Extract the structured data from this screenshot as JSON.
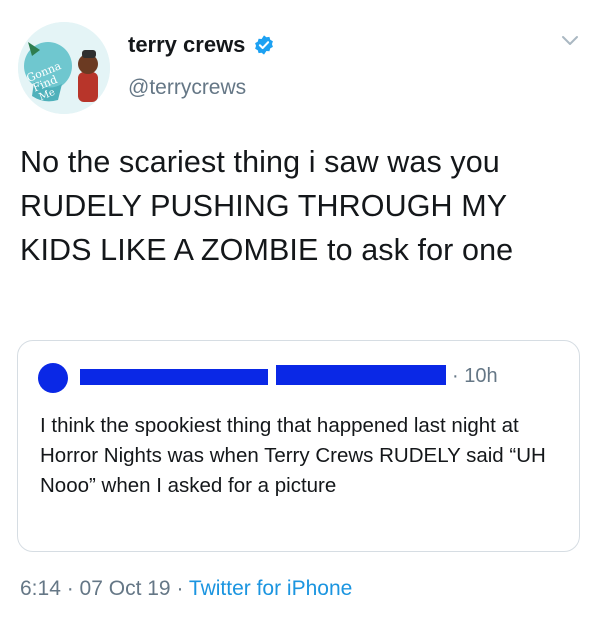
{
  "author": {
    "display_name": "terry crews",
    "handle": "@terrycrews",
    "avatar_text": "Gonna Find Me"
  },
  "tweet": {
    "text": "No the scariest thing i saw was you RUDELY PUSHING THROUGH MY KIDS LIKE A ZOMBIE to ask for one"
  },
  "quoted_tweet": {
    "time": "· 10h",
    "text": "I think the spookiest thing that happened last night at Horror Nights was when Terry Crews RUDELY said “UH Nooo” when I asked for a picture"
  },
  "meta": {
    "time": "6:14",
    "sep1": " · ",
    "date": "07 Oct 19",
    "sep2": " · ",
    "source": "Twitter for iPhone"
  },
  "colors": {
    "verified": "#1da1f2",
    "link": "#1b95e0",
    "redaction": "#0a28e6"
  },
  "icons": [
    "verified-badge-icon",
    "chevron-down-icon"
  ]
}
